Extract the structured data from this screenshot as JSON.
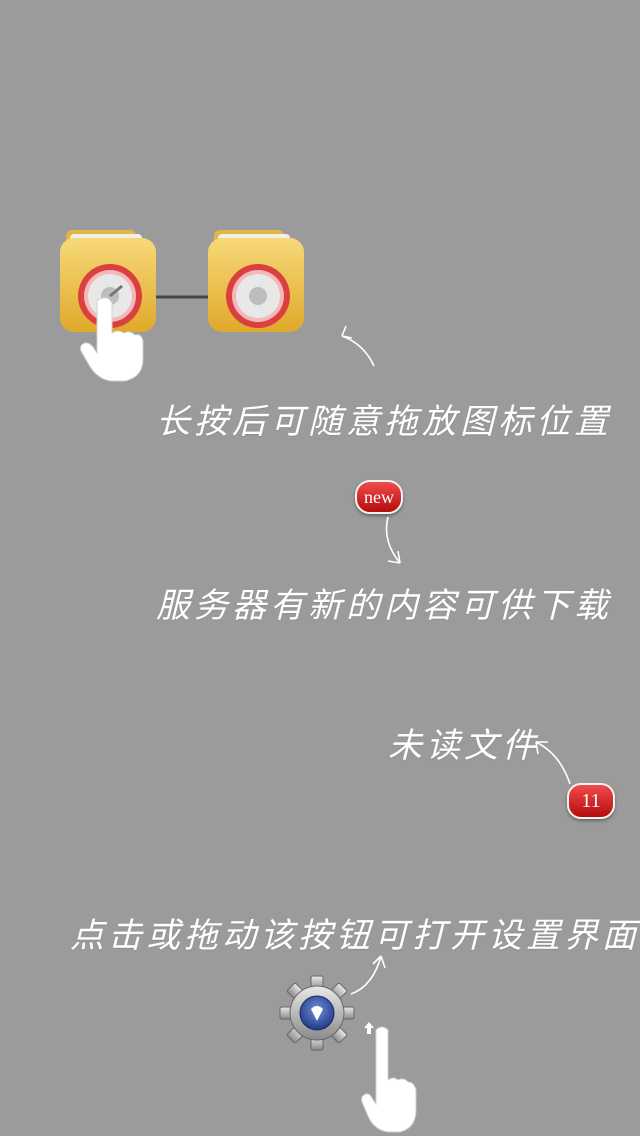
{
  "hints": {
    "drag_icons": "长按后可随意拖放图标位置",
    "new_content": "服务器有新的内容可供下载",
    "unread_files": "未读文件",
    "settings_button": "点击或拖动该按钮可打开设置界面"
  },
  "badges": {
    "new_badge": "new",
    "unread_count": "11"
  },
  "icons": {
    "folder_left": "locked-folder-icon",
    "folder_right": "locked-folder-icon",
    "hand_press": "hand-pointer-icon",
    "hand_drag": "hand-pointer-icon",
    "settings": "gear-icon"
  },
  "colors": {
    "background": "#9b9b9b",
    "folder": "#f2c24c",
    "lock_ring": "#d9403f",
    "badge": "#d41c1c",
    "text": "#ffffff"
  }
}
